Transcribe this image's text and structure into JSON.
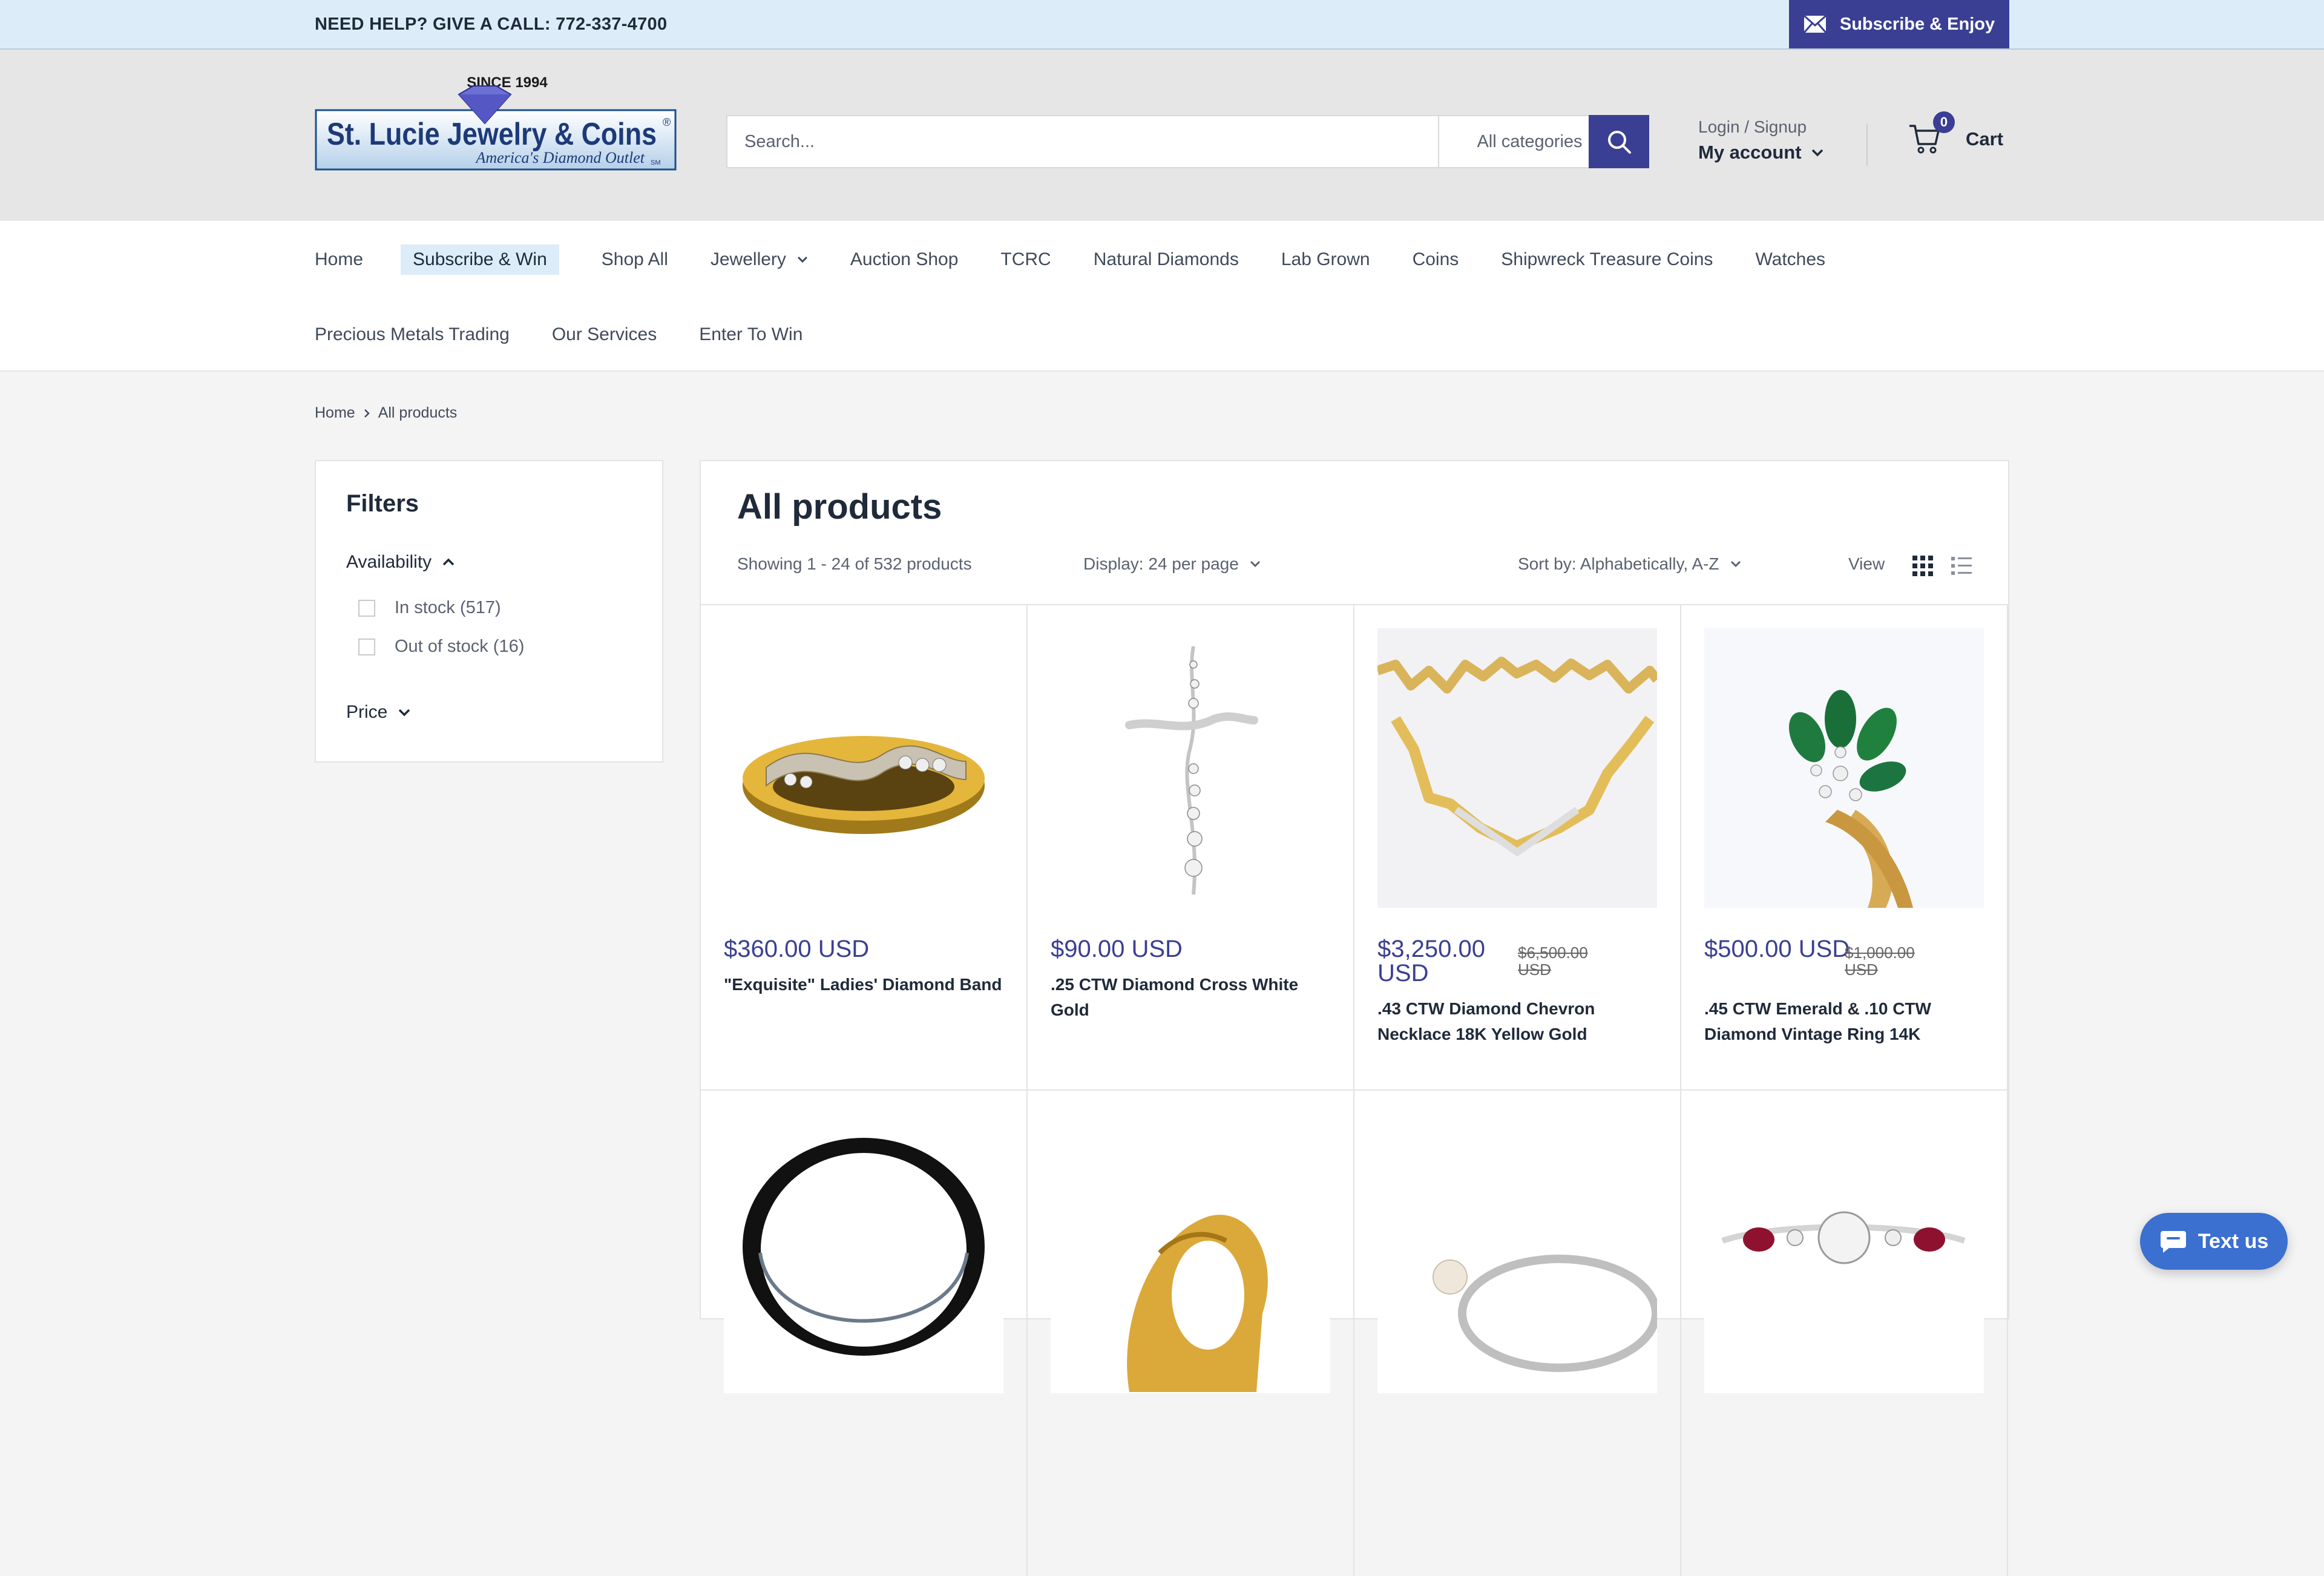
{
  "topbar": {
    "help_text": "NEED HELP? GIVE A CALL: 772-337-4700",
    "subscribe_label": "Subscribe & Enjoy",
    "subscribe_icon": "envelope-icon"
  },
  "logo": {
    "since": "SINCE 1994",
    "name": "St. Lucie Jewelry & Coins",
    "registered": "®",
    "tagline": "America's Diamond Outlet",
    "tm": "SM"
  },
  "search": {
    "placeholder": "Search...",
    "category": "All categories",
    "button_icon": "search-icon"
  },
  "account": {
    "login_label": "Login / Signup",
    "account_label": "My account"
  },
  "cart": {
    "count": "0",
    "label": "Cart"
  },
  "nav": {
    "row1": [
      "Home",
      "Subscribe & Win",
      "Shop All",
      "Jewellery",
      "Auction Shop",
      "TCRC",
      "Natural Diamonds",
      "Lab Grown",
      "Coins",
      "Shipwreck Treasure Coins",
      "Watches"
    ],
    "row2": [
      "Precious Metals Trading",
      "Our Services",
      "Enter To Win"
    ]
  },
  "breadcrumb": {
    "home": "Home",
    "current": "All products"
  },
  "filters": {
    "title": "Filters",
    "availability": "Availability",
    "in_stock": "In stock (517)",
    "out_of_stock": "Out of stock (16)",
    "price": "Price"
  },
  "main": {
    "title": "All products",
    "showing": "Showing 1 - 24 of 532 products",
    "display": "Display: 24 per page",
    "sort": "Sort by: Alphabetically, A-Z",
    "view": "View"
  },
  "products": [
    {
      "price": "$360.00 USD",
      "compare": "",
      "title": "\"Exquisite\" Ladies' Diamond Band"
    },
    {
      "price": "$90.00 USD",
      "compare": "",
      "title": ".25 CTW Diamond Cross White Gold"
    },
    {
      "price": "$3,250.00 USD",
      "compare": "$6,500.00 USD",
      "title": ".43 CTW Diamond Chevron Necklace 18K Yellow Gold"
    },
    {
      "price": "$500.00 USD",
      "compare": "$1,000.00 USD",
      "title": ".45 CTW Emerald & .10 CTW Diamond Vintage Ring 14K"
    }
  ],
  "chat": {
    "label": "Text us"
  },
  "colors": {
    "brand": "#3a3f93",
    "topbar_bg": "#dcedf9",
    "header_bg": "#e6e6e6",
    "chat_button": "#3b6fd0"
  }
}
